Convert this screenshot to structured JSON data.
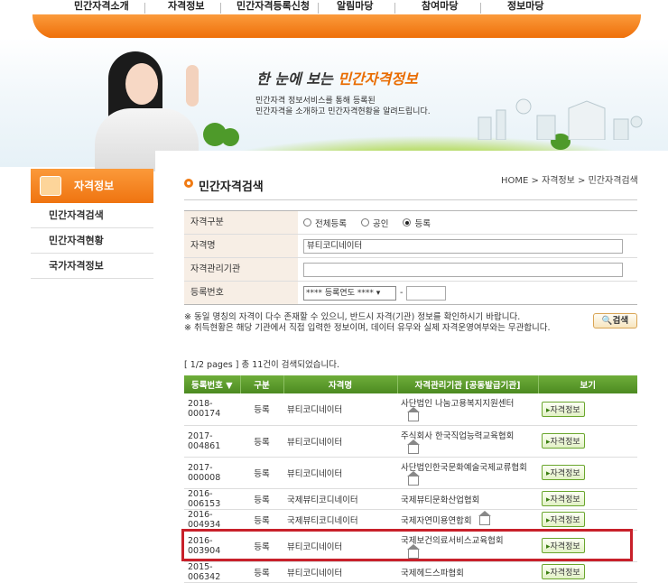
{
  "top_menu": [
    "민간자격소개",
    "자격정보",
    "민간자격등록신청",
    "알림마당",
    "참여마당",
    "정보마당"
  ],
  "banner": {
    "title_prefix": "한 눈에 보는 ",
    "title_highlight": "민간자격정보",
    "desc_line1": "민간자격 정보서비스를 통해 등록된",
    "desc_line2": "민간자격을 소개하고 민간자격현황을 알려드립니다."
  },
  "sidebar": {
    "title": "자격정보",
    "items": [
      "민간자격검색",
      "민간자격현황",
      "국가자격정보"
    ]
  },
  "page": {
    "title": "민간자격검색",
    "breadcrumb": "HOME > 자격정보 > 민간자격검색"
  },
  "form": {
    "type_label": "자격구분",
    "type_options": [
      "전체등록",
      "공인",
      "등록"
    ],
    "type_selected": "등록",
    "name_label": "자격명",
    "name_value": "뷰티코디네이터",
    "org_label": "자격관리기관",
    "org_value": "",
    "regno_label": "등록번호",
    "regno_select": "**** 등록연도 ****",
    "regno_dash": "-"
  },
  "notes": {
    "line1": "※ 동일 명칭의 자격이 다수 존재할 수 있으니, 반드시 자격(기관) 정보를 확인하시기 바랍니다.",
    "line2": "※ 취득현황은 해당 기관에서 직접 입력한 정보이며, 데이터 유무와 실제 자격운영여부와는 무관합니다."
  },
  "search_button": "검색",
  "result_summary": "[ 1/2 pages ] 총 11건이 검색되었습니다.",
  "table": {
    "headers": [
      "등록번호 ▼",
      "구분",
      "자격명",
      "자격관리기관 [공동발급기관]",
      "보기"
    ],
    "rows": [
      {
        "regno": "2018-000174",
        "type": "등록",
        "name": "뷰티코디네이터",
        "org": "사단법인 나눔고용복지지원센터",
        "btn": "자격정보"
      },
      {
        "regno": "2017-004861",
        "type": "등록",
        "name": "뷰티코디네이터",
        "org": "주식회사 한국직업능력교육협회",
        "btn": "자격정보"
      },
      {
        "regno": "2017-000008",
        "type": "등록",
        "name": "뷰티코디네이터",
        "org": "사단법인한국문화예술국제교류협회",
        "btn": "자격정보"
      },
      {
        "regno": "2016-006153",
        "type": "등록",
        "name": "국제뷰티코디네이터",
        "org": "국제뷰티문화산업협회",
        "btn": "자격정보"
      },
      {
        "regno": "2016-004934",
        "type": "등록",
        "name": "국제뷰티코디네이터",
        "org": "국제자연미용연합회",
        "btn": "자격정보"
      },
      {
        "regno": "2016-003904",
        "type": "등록",
        "name": "뷰티코디네이터",
        "org": "국제보건의료서비스교육협회",
        "btn": "자격정보"
      },
      {
        "regno": "2015-006342",
        "type": "등록",
        "name": "뷰티코디네이터",
        "org": "국제헤드스파협회",
        "btn": "자격정보"
      }
    ]
  }
}
